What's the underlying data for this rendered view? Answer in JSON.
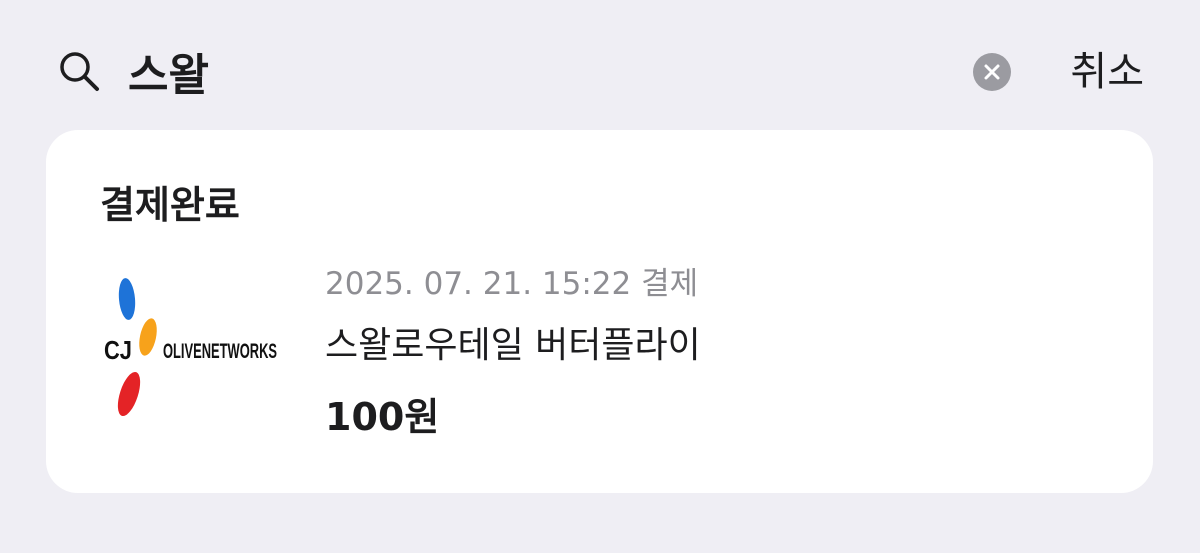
{
  "search": {
    "query": "스왈",
    "cancel_label": "취소"
  },
  "results": {
    "section_title": "결제완료",
    "items": [
      {
        "datetime_label": "2025. 07. 21. 15:22 결제",
        "name": "스왈로우테일 버터플라이",
        "amount": "100원",
        "logo": {
          "left_text": "CJ",
          "right_text": "OLIVENETWORKS",
          "colors": [
            "#1e73d8",
            "#f7a21b",
            "#e42326"
          ]
        }
      }
    ]
  }
}
